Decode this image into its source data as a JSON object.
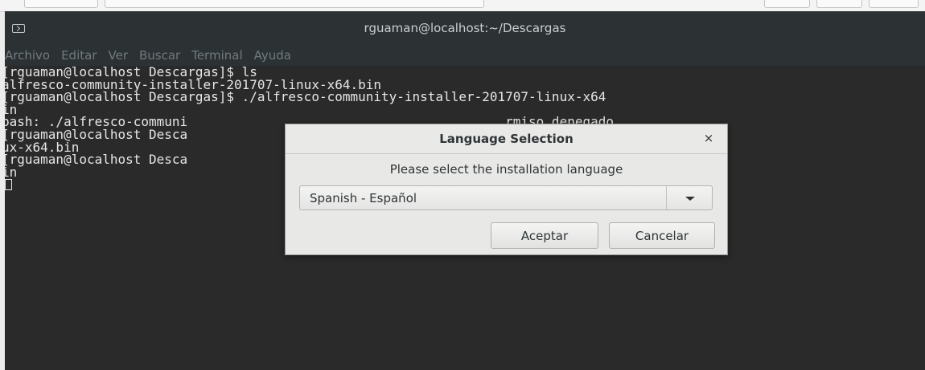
{
  "terminal": {
    "title": "rguaman@localhost:~/Descargas",
    "menu": [
      "Archivo",
      "Editar",
      "Ver",
      "Buscar",
      "Terminal",
      "Ayuda"
    ],
    "lines": [
      "[rguaman@localhost Descargas]$ ls",
      "alfresco-community-installer-201707-linux-x64.bin",
      "[rguaman@localhost Descargas]$ ./alfresco-community-installer-201707-linux-x64",
      "in",
      "bash: ./alfresco-communi                                         rmiso denegado",
      "[rguaman@localhost Desca                                         nstaller-201707-l",
      "ux-x64.bin",
      "[rguaman@localhost Desca                                         -201707-linux-x64",
      "in"
    ]
  },
  "dialog": {
    "title": "Language Selection",
    "close_label": "×",
    "prompt": "Please select the installation language",
    "selected_language": "Spanish - Español",
    "ok_label": "Aceptar",
    "cancel_label": "Cancelar"
  }
}
